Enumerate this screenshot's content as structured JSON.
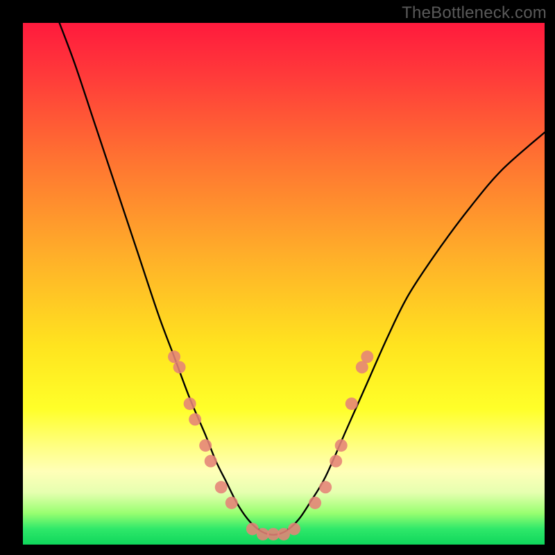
{
  "watermark": "TheBottleneck.com",
  "chart_data": {
    "type": "line",
    "title": "",
    "xlabel": "",
    "ylabel": "",
    "xlim": [
      0,
      100
    ],
    "ylim": [
      0,
      100
    ],
    "grid": false,
    "series": [
      {
        "name": "curve",
        "color": "#000000",
        "x": [
          7,
          10,
          14,
          18,
          22,
          26,
          29,
          32,
          35,
          37,
          39,
          41,
          43,
          45,
          47,
          49,
          51,
          53,
          55,
          58,
          62,
          66,
          70,
          74,
          80,
          86,
          92,
          100
        ],
        "y": [
          100,
          92,
          80,
          68,
          56,
          44,
          36,
          28,
          21,
          16,
          12,
          8,
          5,
          3,
          2,
          2,
          3,
          5,
          8,
          13,
          22,
          31,
          40,
          48,
          57,
          65,
          72,
          79
        ]
      }
    ],
    "annotations": [
      {
        "name": "markers",
        "shape": "circle",
        "color": "#e58377",
        "radius_px": 9,
        "points": [
          {
            "x": 29,
            "y": 36
          },
          {
            "x": 30,
            "y": 34
          },
          {
            "x": 32,
            "y": 27
          },
          {
            "x": 33,
            "y": 24
          },
          {
            "x": 35,
            "y": 19
          },
          {
            "x": 36,
            "y": 16
          },
          {
            "x": 38,
            "y": 11
          },
          {
            "x": 40,
            "y": 8
          },
          {
            "x": 44,
            "y": 3
          },
          {
            "x": 46,
            "y": 2
          },
          {
            "x": 48,
            "y": 2
          },
          {
            "x": 50,
            "y": 2
          },
          {
            "x": 52,
            "y": 3
          },
          {
            "x": 56,
            "y": 8
          },
          {
            "x": 58,
            "y": 11
          },
          {
            "x": 60,
            "y": 16
          },
          {
            "x": 61,
            "y": 19
          },
          {
            "x": 63,
            "y": 27
          },
          {
            "x": 65,
            "y": 34
          },
          {
            "x": 66,
            "y": 36
          }
        ]
      }
    ]
  }
}
